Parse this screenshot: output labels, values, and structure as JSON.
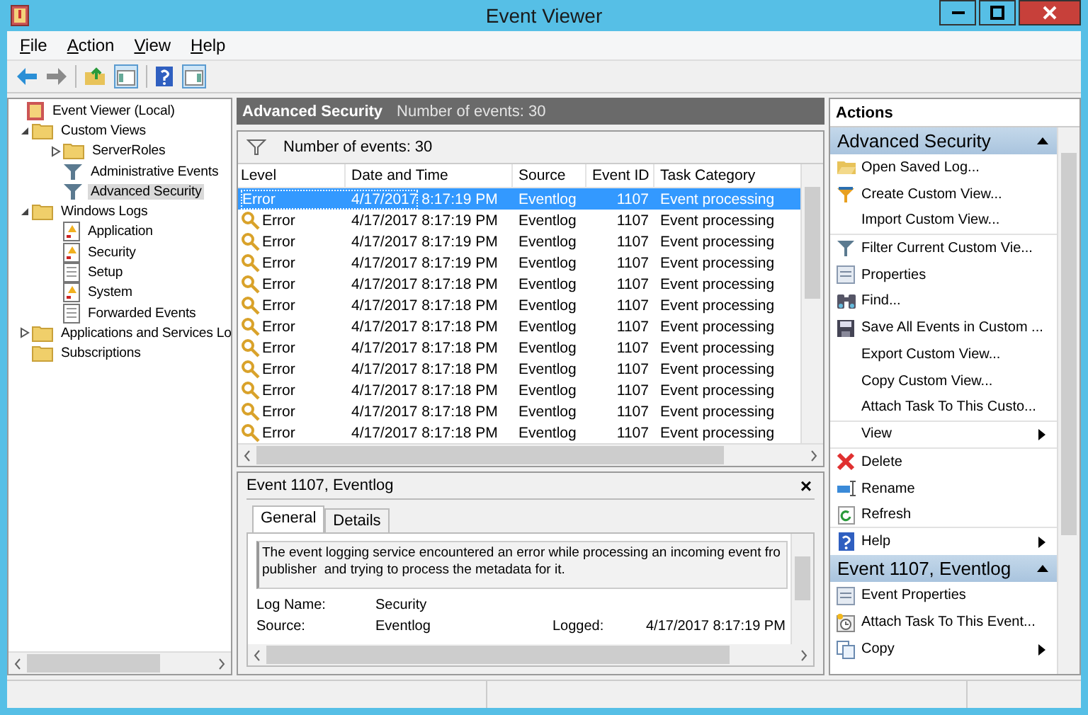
{
  "window": {
    "title": "Event Viewer"
  },
  "menu": [
    "File",
    "Action",
    "View",
    "Help"
  ],
  "tree": [
    {
      "label": "Event Viewer (Local)",
      "kind": "root",
      "selected": false,
      "children": [
        {
          "label": "Custom Views",
          "kind": "folder",
          "expanded": true,
          "selected": false,
          "children": [
            {
              "label": "ServerRoles",
              "kind": "folder",
              "expanded": false,
              "selected": false
            },
            {
              "label": "Administrative Events",
              "kind": "filter",
              "selected": false
            },
            {
              "label": "Advanced Security",
              "kind": "filter",
              "selected": true
            }
          ]
        },
        {
          "label": "Windows Logs",
          "kind": "folder",
          "expanded": true,
          "selected": false,
          "children": [
            {
              "label": "Application",
              "kind": "log",
              "selected": false
            },
            {
              "label": "Security",
              "kind": "log",
              "selected": false
            },
            {
              "label": "Setup",
              "kind": "plain",
              "selected": false
            },
            {
              "label": "System",
              "kind": "log",
              "selected": false
            },
            {
              "label": "Forwarded Events",
              "kind": "plain",
              "selected": false
            }
          ]
        },
        {
          "label": "Applications and Services Lo",
          "kind": "folder",
          "expanded": false,
          "selected": false
        },
        {
          "label": "Subscriptions",
          "kind": "folder",
          "selected": false
        }
      ]
    }
  ],
  "list_header": {
    "title": "Advanced Security",
    "count": "Number of events: 30"
  },
  "filter_bar": "Number of events: 30",
  "table": {
    "columns": [
      "Level",
      "Date and Time",
      "Source",
      "Event ID",
      "Task Category"
    ],
    "rows": [
      {
        "cells": [
          "Error",
          "4/17/2017 8:17:19 PM",
          "Eventlog",
          "1107",
          "Event processing"
        ],
        "selected": true
      },
      {
        "cells": [
          "Error",
          "4/17/2017 8:17:19 PM",
          "Eventlog",
          "1107",
          "Event processing"
        ],
        "selected": false
      },
      {
        "cells": [
          "Error",
          "4/17/2017 8:17:19 PM",
          "Eventlog",
          "1107",
          "Event processing"
        ],
        "selected": false
      },
      {
        "cells": [
          "Error",
          "4/17/2017 8:17:19 PM",
          "Eventlog",
          "1107",
          "Event processing"
        ],
        "selected": false
      },
      {
        "cells": [
          "Error",
          "4/17/2017 8:17:18 PM",
          "Eventlog",
          "1107",
          "Event processing"
        ],
        "selected": false
      },
      {
        "cells": [
          "Error",
          "4/17/2017 8:17:18 PM",
          "Eventlog",
          "1107",
          "Event processing"
        ],
        "selected": false
      },
      {
        "cells": [
          "Error",
          "4/17/2017 8:17:18 PM",
          "Eventlog",
          "1107",
          "Event processing"
        ],
        "selected": false
      },
      {
        "cells": [
          "Error",
          "4/17/2017 8:17:18 PM",
          "Eventlog",
          "1107",
          "Event processing"
        ],
        "selected": false
      },
      {
        "cells": [
          "Error",
          "4/17/2017 8:17:18 PM",
          "Eventlog",
          "1107",
          "Event processing"
        ],
        "selected": false
      },
      {
        "cells": [
          "Error",
          "4/17/2017 8:17:18 PM",
          "Eventlog",
          "1107",
          "Event processing"
        ],
        "selected": false
      },
      {
        "cells": [
          "Error",
          "4/17/2017 8:17:18 PM",
          "Eventlog",
          "1107",
          "Event processing"
        ],
        "selected": false
      },
      {
        "cells": [
          "Error",
          "4/17/2017 8:17:18 PM",
          "Eventlog",
          "1107",
          "Event processing"
        ],
        "selected": false
      }
    ]
  },
  "detail": {
    "title": "Event 1107, Eventlog",
    "close": "×",
    "tabs": [
      {
        "label": "General",
        "selected": true
      },
      {
        "label": "Details",
        "selected": false
      }
    ],
    "description": "The event logging service encountered an error while processing an incoming event fro\npublisher  and trying to process the metadata for it.",
    "fields": [
      {
        "label": "Log Name:",
        "value": "Security"
      },
      {
        "label": "Source:",
        "value": "Eventlog",
        "label_2": "Logged:",
        "value_2": "4/17/2017 8:17:19 PM"
      }
    ]
  },
  "actions": {
    "title": "Actions",
    "sections": [
      {
        "title": "Advanced Security",
        "items": [
          {
            "label": "Open Saved Log...",
            "kind": "open",
            "submenu": false,
            "separator_after": false
          },
          {
            "label": "Create Custom View...",
            "kind": "newfilter",
            "submenu": false,
            "separator_after": false
          },
          {
            "label": "Import Custom View...",
            "kind": "none",
            "submenu": false,
            "separator_after": true
          },
          {
            "label": "Filter Current Custom Vie...",
            "kind": "filter",
            "submenu": false,
            "separator_after": false
          },
          {
            "label": "Properties",
            "kind": "properties",
            "submenu": false,
            "separator_after": false
          },
          {
            "label": "Find...",
            "kind": "find",
            "submenu": false,
            "separator_after": false
          },
          {
            "label": "Save All Events in Custom ...",
            "kind": "save",
            "submenu": false,
            "separator_after": false
          },
          {
            "label": "Export Custom View...",
            "kind": "none",
            "submenu": false,
            "separator_after": false
          },
          {
            "label": "Copy Custom View...",
            "kind": "none",
            "submenu": false,
            "separator_after": false
          },
          {
            "label": "Attach Task To This Custo...",
            "kind": "none",
            "submenu": false,
            "separator_after": true
          },
          {
            "label": "View",
            "kind": "none",
            "submenu": true,
            "separator_after": true
          },
          {
            "label": "Delete",
            "kind": "delete",
            "submenu": false,
            "separator_after": false
          },
          {
            "label": "Rename",
            "kind": "rename",
            "submenu": false,
            "separator_after": false
          },
          {
            "label": "Refresh",
            "kind": "refresh",
            "submenu": false,
            "separator_after": true
          },
          {
            "label": "Help",
            "kind": "help",
            "submenu": true,
            "separator_after": false
          }
        ]
      },
      {
        "title": "Event 1107, Eventlog",
        "items": [
          {
            "label": "Event Properties",
            "kind": "properties",
            "submenu": false,
            "separator_after": false
          },
          {
            "label": "Attach Task To This Event...",
            "kind": "task",
            "submenu": false,
            "separator_after": false
          },
          {
            "label": "Copy",
            "kind": "copy",
            "submenu": true,
            "separator_after": false
          }
        ]
      }
    ]
  }
}
